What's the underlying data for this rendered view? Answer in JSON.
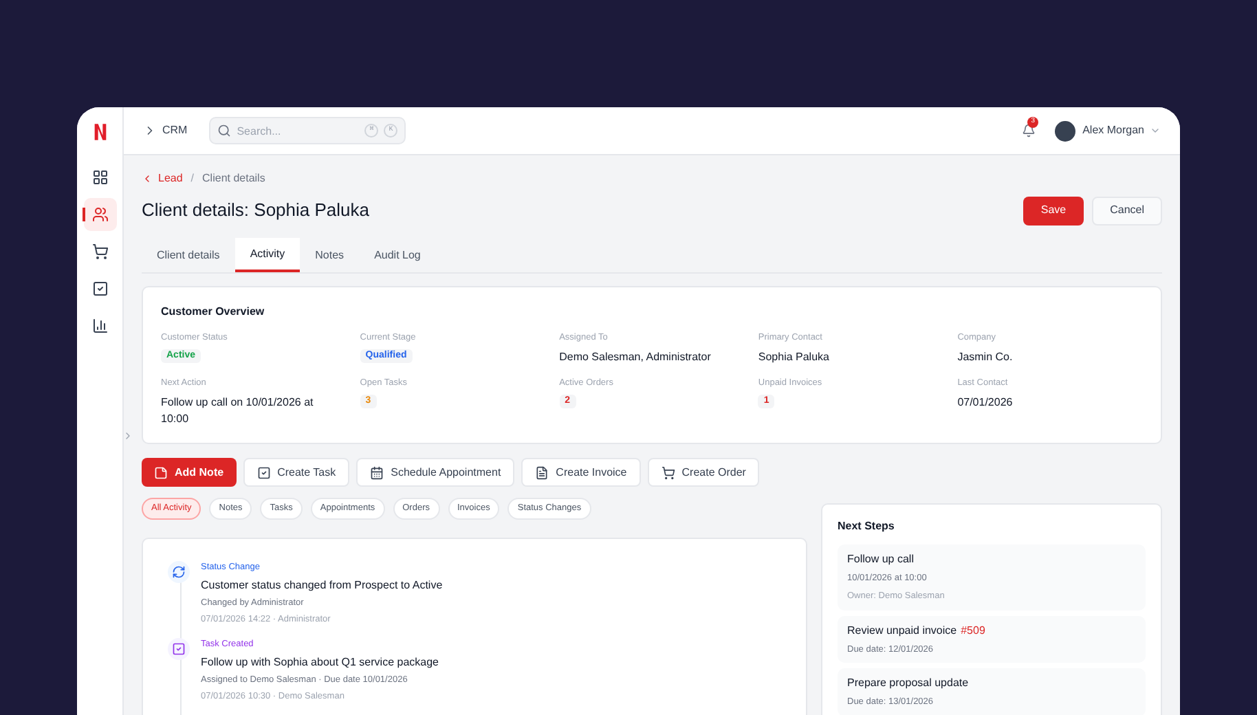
{
  "sidebar": {
    "items": [
      {
        "selected": false
      },
      {
        "selected": true
      },
      {
        "selected": false
      },
      {
        "selected": false
      },
      {
        "selected": false
      }
    ]
  },
  "topbar": {
    "section": "CRM",
    "search": {
      "placeholder": "Search...",
      "shortcut": [
        "⌘",
        "K"
      ]
    },
    "notifications": "3",
    "user": "Alex Morgan"
  },
  "breadcrumb": {
    "parent": "Lead",
    "separator": "/",
    "current": "Client details"
  },
  "title": "Client details: Sophia Paluka",
  "actions": [
    {
      "label": "Save",
      "kind": "primary"
    },
    {
      "label": "Cancel",
      "kind": "secondary"
    }
  ],
  "tabs": [
    {
      "label": "Client details",
      "selected": false
    },
    {
      "label": "Activity",
      "selected": true
    },
    {
      "label": "Notes",
      "selected": false
    },
    {
      "label": "Audit Log",
      "selected": false
    }
  ],
  "overview": {
    "title": "Customer Overview",
    "fields": [
      {
        "label": "Customer Status",
        "value": "Active",
        "kind": "badge",
        "color": "#16a34a"
      },
      {
        "label": "Current Stage",
        "value": "Qualified",
        "kind": "badge",
        "color": "#2563eb"
      },
      {
        "label": "Assigned To",
        "value": "Demo Salesman, Administrator",
        "kind": "text"
      },
      {
        "label": "Primary Contact",
        "value": "Sophia Paluka",
        "kind": "text"
      },
      {
        "label": "Company",
        "value": "Jasmin Co.",
        "kind": "text"
      },
      {
        "label": "Next Action",
        "value": "Follow up call on 10/01/2026 at 10:00",
        "kind": "text"
      },
      {
        "label": "Open Tasks",
        "value": "3",
        "kind": "badge",
        "color": "#ea8a0c"
      },
      {
        "label": "Active Orders",
        "value": "2",
        "kind": "badge",
        "color": "#dc2626"
      },
      {
        "label": "Unpaid Invoices",
        "value": "1",
        "kind": "badge",
        "color": "#dc2626"
      },
      {
        "label": "Last Contact",
        "value": "07/01/2026",
        "kind": "text"
      }
    ]
  },
  "quick_actions": [
    {
      "label": "Add Note",
      "kind": "primary"
    },
    {
      "label": "Create Task",
      "kind": "secondary"
    },
    {
      "label": "Schedule Appointment",
      "kind": "secondary"
    },
    {
      "label": "Create Invoice",
      "kind": "secondary"
    },
    {
      "label": "Create Order",
      "kind": "secondary"
    }
  ],
  "filters": [
    {
      "label": "All Activity",
      "selected": true
    },
    {
      "label": "Notes",
      "selected": false
    },
    {
      "label": "Tasks",
      "selected": false
    },
    {
      "label": "Appointments",
      "selected": false
    },
    {
      "label": "Orders",
      "selected": false
    },
    {
      "label": "Invoices",
      "selected": false
    },
    {
      "label": "Status Changes",
      "selected": false
    }
  ],
  "activity": [
    {
      "kind": "status_change",
      "type": "Status Change",
      "title": "Customer status changed from Prospect to Active",
      "detail": "Changed by Administrator",
      "meta": "07/01/2026 14:22 · Administrator"
    },
    {
      "kind": "task_created",
      "type": "Task Created",
      "title": "Follow up with Sophia about Q1 service package",
      "detail": "Assigned to Demo Salesman · Due date 10/01/2026",
      "meta": "07/01/2026 10:30 · Demo Salesman"
    }
  ],
  "next_steps": {
    "title": "Next Steps",
    "items": [
      {
        "title": "Follow up call",
        "lines": [
          "10/01/2026 at 10:00",
          "Owner: Demo Salesman"
        ]
      },
      {
        "title": "Review unpaid invoice",
        "ref": "#509",
        "lines": [
          "Due date: 12/01/2026"
        ]
      },
      {
        "title": "Prepare proposal update",
        "lines": [
          "Due date: 13/01/2026"
        ]
      }
    ]
  }
}
